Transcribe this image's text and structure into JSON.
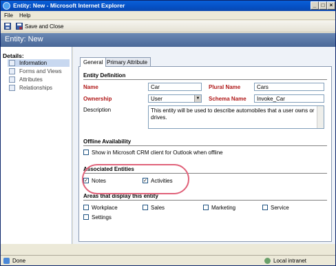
{
  "window": {
    "title": "Entity: New - Microsoft Internet Explorer",
    "buttons": [
      "_",
      "□",
      "×"
    ]
  },
  "menu": {
    "items": [
      "File",
      "Help"
    ]
  },
  "toolbar": {
    "save_close_label": "Save and Close"
  },
  "page": {
    "header": "Entity: New"
  },
  "nav": {
    "header": "Details:",
    "items": [
      "Information",
      "Forms and Views",
      "Attributes",
      "Relationships"
    ],
    "selected": "Information"
  },
  "tabs": [
    "General",
    "Primary Attribute"
  ],
  "entity_definition": {
    "title": "Entity Definition",
    "name_label": "Name",
    "name_value": "Car",
    "plural_label": "Plural Name",
    "plural_value": "Cars",
    "ownership_label": "Ownership",
    "ownership_value": "User",
    "schema_label": "Schema Name",
    "schema_value": "Invoke_Car",
    "description_label": "Description",
    "description_value": "This entity will be used to describe automobiles that a user owns or drives."
  },
  "offline": {
    "title": "Offline Availability",
    "checkbox_label": "Show in Microsoft CRM client for Outlook when offline",
    "checked": false
  },
  "associated": {
    "title": "Associated Entities",
    "notes_label": "Notes",
    "notes_checked": true,
    "activities_label": "Activities",
    "activities_checked": true
  },
  "areas": {
    "title": "Areas that display this entity",
    "items": [
      "Workplace",
      "Sales",
      "Marketing",
      "Service",
      "Settings"
    ]
  },
  "status": {
    "left": "Done",
    "right": "Local intranet"
  },
  "colors": {
    "title_bar": "#0550c4",
    "header": "#5a78a8",
    "required": "#b01818",
    "highlight": "#e06078"
  }
}
